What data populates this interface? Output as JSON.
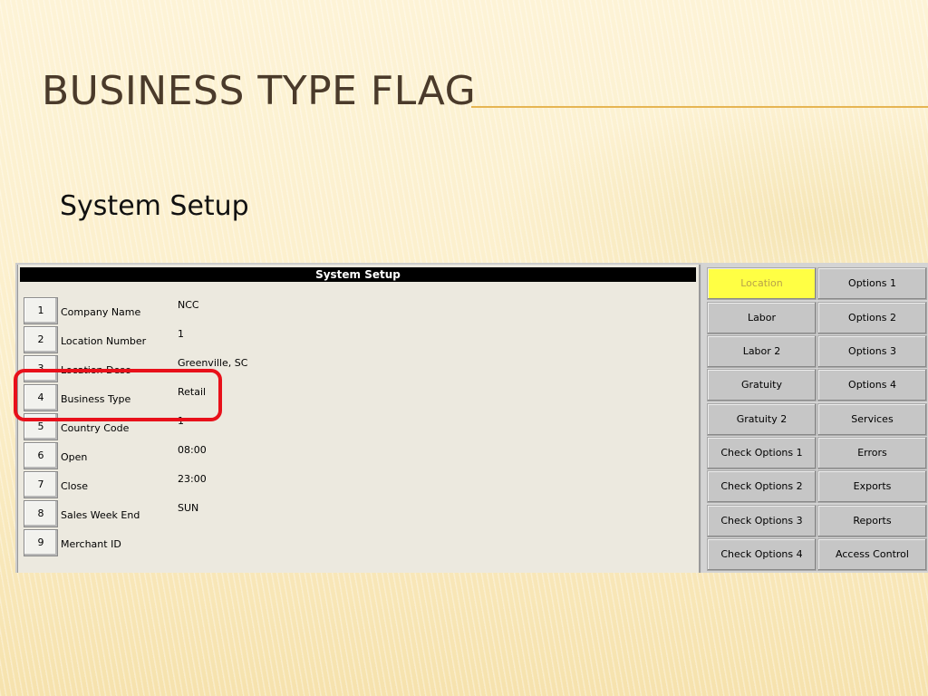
{
  "slide": {
    "title": "BUSINESS TYPE FLAG",
    "subtitle": "System Setup"
  },
  "panel": {
    "header": "System Setup",
    "fields": [
      {
        "num": "1",
        "label": "Company Name",
        "value": "NCC"
      },
      {
        "num": "2",
        "label": "Location Number",
        "value": "1"
      },
      {
        "num": "3",
        "label": "Location Desc",
        "value": "Greenville, SC"
      },
      {
        "num": "4",
        "label": "Business Type",
        "value": "Retail"
      },
      {
        "num": "5",
        "label": "Country Code",
        "value": "1"
      },
      {
        "num": "6",
        "label": "Open",
        "value": "08:00"
      },
      {
        "num": "7",
        "label": "Close",
        "value": "23:00"
      },
      {
        "num": "8",
        "label": "Sales Week End",
        "value": "SUN"
      },
      {
        "num": "9",
        "label": "Merchant ID",
        "value": ""
      }
    ]
  },
  "nav": {
    "left": [
      "Location",
      "Labor",
      "Labor 2",
      "Gratuity",
      "Gratuity 2",
      "Check Options 1",
      "Check Options 2",
      "Check Options 3",
      "Check Options 4"
    ],
    "right": [
      "Options 1",
      "Options 2",
      "Options 3",
      "Options 4",
      "Services",
      "Errors",
      "Exports",
      "Reports",
      "Access Control"
    ],
    "active": "Location"
  },
  "colors": {
    "active_button": "#ffff44",
    "highlight_ring": "#e8101a",
    "title_rule": "#e6b552"
  }
}
